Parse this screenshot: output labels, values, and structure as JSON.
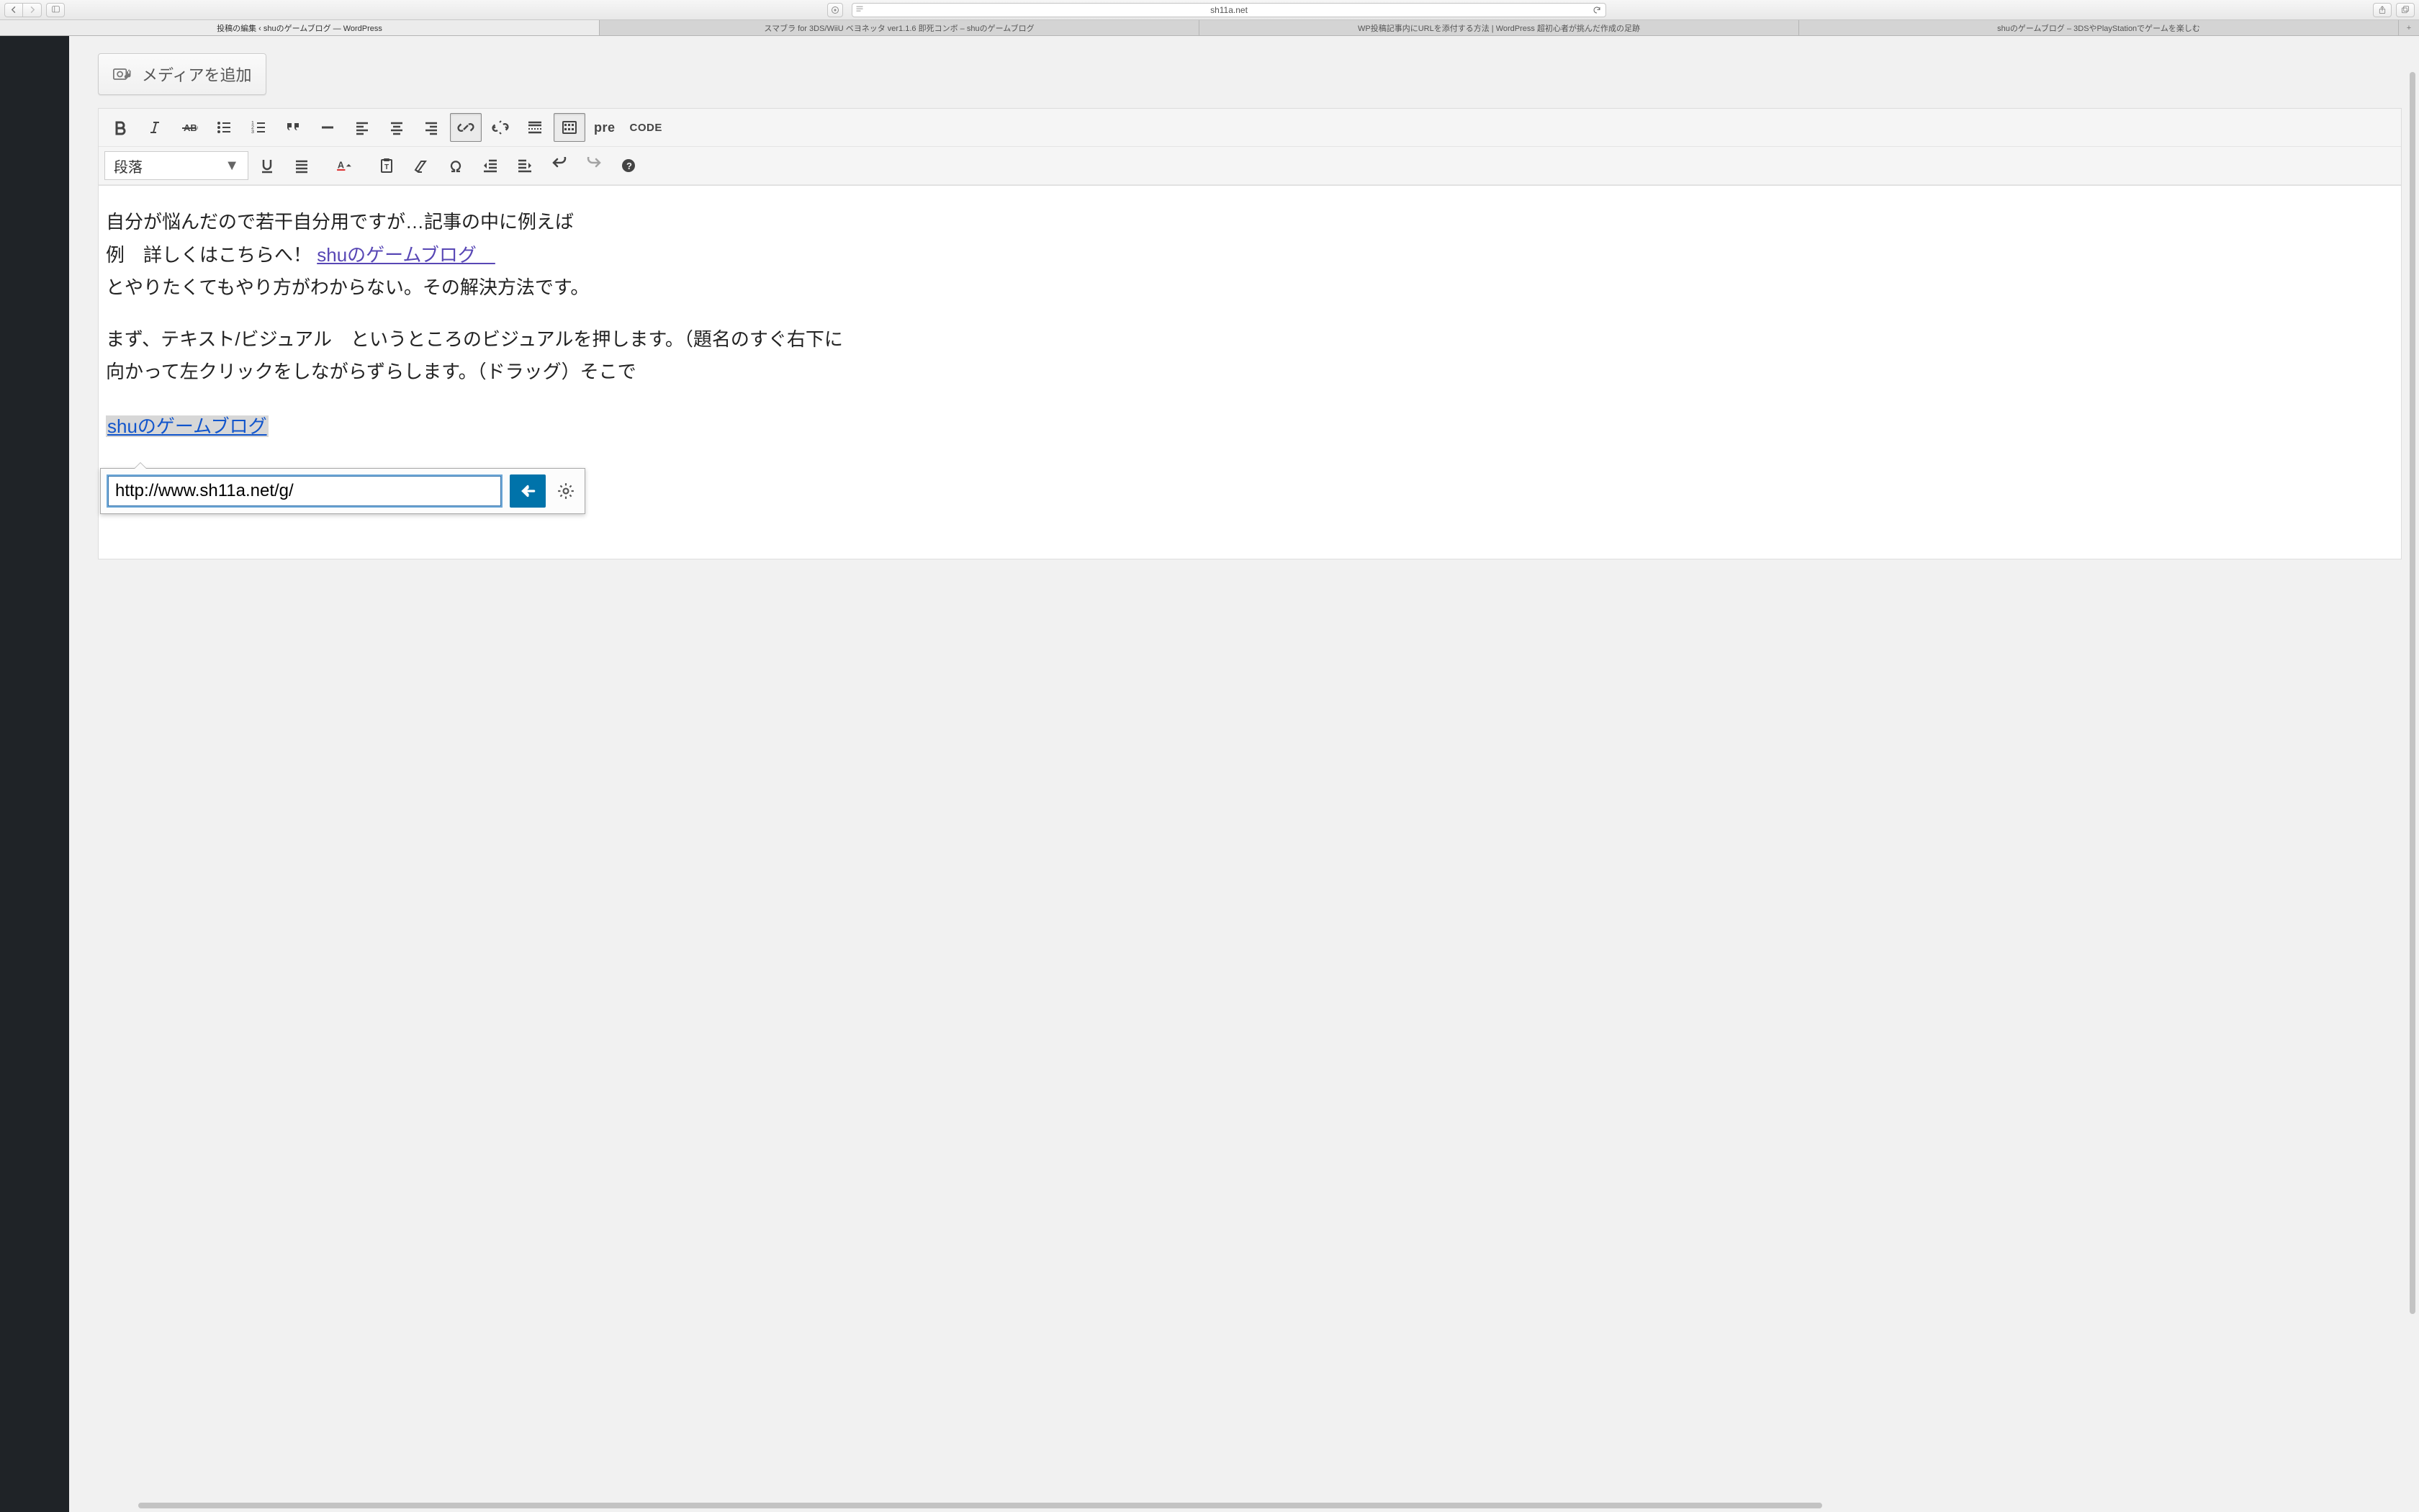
{
  "browser": {
    "url_host": "sh11a.net",
    "tabs": [
      "投稿の編集 ‹ shuのゲームブログ — WordPress",
      "スマブラ for 3DS/WiiU ベヨネッタ ver1.1.6 即死コンボ – shuのゲームブログ",
      "WP投稿記事内にURLを添付する方法 | WordPress 超初心者が挑んだ作成の足跡",
      "shuのゲームブログ – 3DSやPlayStationでゲームを楽しむ"
    ]
  },
  "editor": {
    "media_button": "メディアを追加",
    "format_select": "段落",
    "pre_label": "pre",
    "code_label": "CODE",
    "content": {
      "p1a": "自分が悩んだので若干自分用ですが…記事の中に例えば",
      "p1b_prefix": "例　詳しくはこちらへ！ ",
      "p1b_link": " shuのゲームブログ　",
      "p1c": "とやりたくてもやり方がわからない。その解決方法です。",
      "p2a": "まず、テキスト/ビジュアル　というところのビジュアルを押します。（題名のすぐ右下に",
      "p2b": "向かって左クリックをしながらずらします。（ドラッグ）そこで",
      "selected_link": "shuのゲームブログ"
    },
    "link_popup": {
      "url": "http://www.sh11a.net/g/"
    }
  }
}
